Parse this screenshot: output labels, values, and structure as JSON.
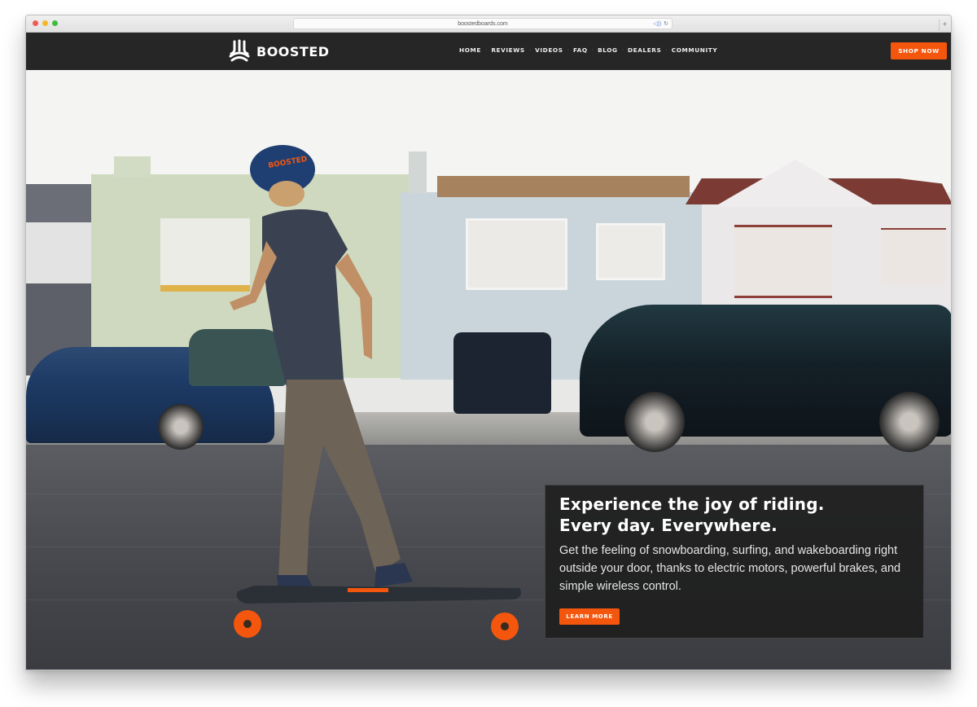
{
  "browser": {
    "url": "boostedboards.com",
    "audio_icon": "speaker-icon",
    "reload_icon": "reload-icon",
    "new_tab_label": "+"
  },
  "nav": {
    "brand": "BOOSTED",
    "items": [
      {
        "label": "HOME"
      },
      {
        "label": "REVIEWS"
      },
      {
        "label": "VIDEOS"
      },
      {
        "label": "FAQ"
      },
      {
        "label": "BLOG"
      },
      {
        "label": "DEALERS"
      },
      {
        "label": "COMMUNITY"
      }
    ],
    "separator": "·",
    "cta": "SHOP NOW"
  },
  "hero": {
    "title_line1": "Experience the joy of riding.",
    "title_line2": "Every day. Everywhere.",
    "body": "Get the feeling of snowboarding, surfing, and wakeboarding right outside your door, thanks to electric motors, powerful brakes, and simple wireless control.",
    "cta": "LEARN MORE",
    "image_description": "Rider in blue helmet on electric skateboard on street with blurred cars and houses",
    "helmet_text": "BOOSTED"
  },
  "colors": {
    "accent": "#f4560d",
    "nav_bg": "#262626",
    "panel_bg": "#1e1e1e"
  }
}
